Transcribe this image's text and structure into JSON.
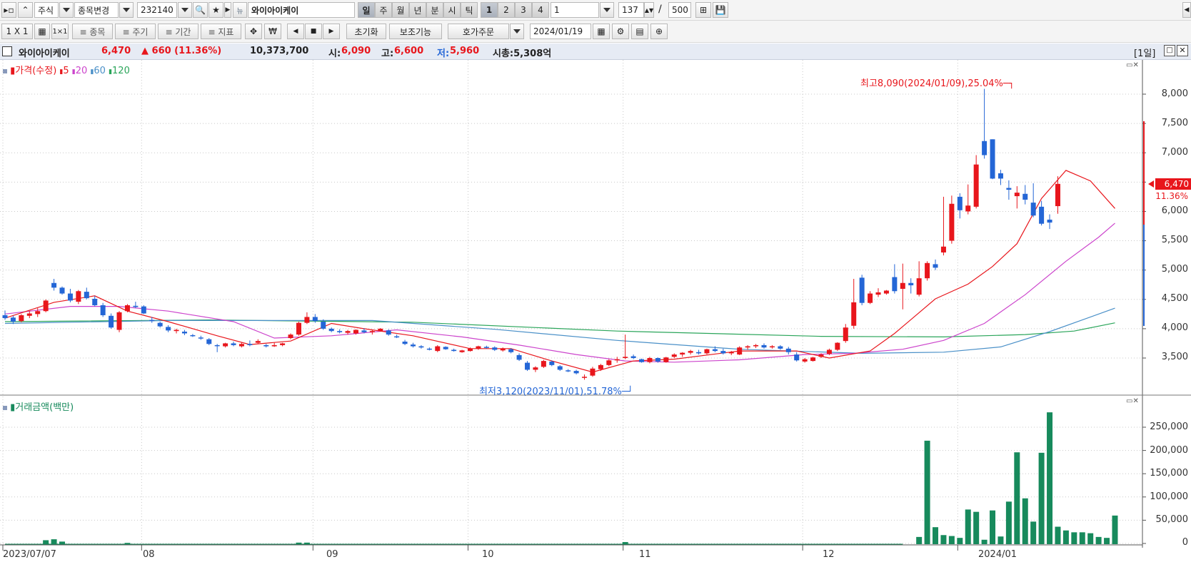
{
  "toolbar1": {
    "market": "주식",
    "change_label": "종목변경",
    "code": "232140",
    "name": "와이아이케이",
    "periods": [
      "일",
      "주",
      "월",
      "년",
      "분",
      "시",
      "틱"
    ],
    "nums": [
      "1",
      "2",
      "3",
      "4"
    ],
    "num_value": "1",
    "count": "137",
    "slash": "/",
    "max": "500"
  },
  "toolbar2": {
    "layout": "1 X 1",
    "b_item": "≡ 종목",
    "b_period": "≡ 주기",
    "b_range": "≡ 기간",
    "b_indicator": "≡ 지표",
    "reset": "초기화",
    "aux": "보조기능",
    "order": "호가주문",
    "date": "2024/01/19"
  },
  "info": {
    "name": "와이아이케이",
    "price": "6,470",
    "change": "▲ 660 (11.36%)",
    "volume": "10,373,700",
    "open_label": "시:",
    "open": "6,090",
    "high_label": "고:",
    "high": "6,600",
    "low_label": "저:",
    "low": "5,960",
    "cap": "시총:5,308억",
    "period_tag": "[1일]"
  },
  "price_panel": {
    "legend_title": "가격(수정)",
    "ma": [
      "5",
      "20",
      "60",
      "120"
    ],
    "high_note": "최고8,090(2024/01/09),25.04%",
    "low_note": "최저3,120(2023/11/01),51.78%",
    "last_price": "6,470",
    "last_pct": "11.36%",
    "y_ticks": [
      "8,000",
      "7,500",
      "7,000",
      "6,500",
      "6,000",
      "5,500",
      "5,000",
      "4,500",
      "4,000",
      "3,500"
    ]
  },
  "volume_panel": {
    "legend_title": "거래금액(백만)",
    "y_ticks": [
      "250,000",
      "200,000",
      "150,000",
      "100,000",
      "50,000",
      "0"
    ]
  },
  "x_labels": [
    "2023/07/07",
    "08",
    "09",
    "10",
    "11",
    "12",
    "2024/01"
  ],
  "colors": {
    "up": "#e8161c",
    "down": "#2466d6",
    "ma5": "#e8161c",
    "ma20": "#cc44cc",
    "ma60": "#4a90c8",
    "ma120": "#2aa55a",
    "vol": "#178a5c"
  },
  "chart_data": {
    "type": "candlestick",
    "ylim": [
      3000,
      8300
    ],
    "candles": [
      [
        4230,
        4310,
        4150,
        4180
      ],
      [
        4190,
        4220,
        4080,
        4120
      ],
      [
        4130,
        4250,
        4110,
        4230
      ],
      [
        4220,
        4300,
        4180,
        4260
      ],
      [
        4250,
        4350,
        4200,
        4300
      ],
      [
        4300,
        4500,
        4280,
        4480
      ],
      [
        4780,
        4850,
        4650,
        4700
      ],
      [
        4700,
        4720,
        4580,
        4600
      ],
      [
        4600,
        4680,
        4450,
        4480
      ],
      [
        4460,
        4660,
        4420,
        4640
      ],
      [
        4630,
        4700,
        4500,
        4520
      ],
      [
        4510,
        4560,
        4380,
        4400
      ],
      [
        4400,
        4440,
        4200,
        4230
      ],
      [
        4220,
        4260,
        4000,
        4020
      ],
      [
        3980,
        4300,
        3940,
        4280
      ],
      [
        4300,
        4420,
        4280,
        4400
      ],
      [
        4390,
        4460,
        4350,
        4370
      ],
      [
        4380,
        4400,
        4250,
        4260
      ],
      [
        4150,
        4200,
        4100,
        4130
      ],
      [
        4100,
        4120,
        4020,
        4040
      ],
      [
        4030,
        4060,
        3940,
        3970
      ],
      [
        3960,
        4000,
        3920,
        3980
      ],
      [
        3950,
        3980,
        3890,
        3920
      ],
      [
        3890,
        3910,
        3860,
        3880
      ],
      [
        3850,
        3880,
        3810,
        3840
      ],
      [
        3820,
        3840,
        3720,
        3740
      ],
      [
        3720,
        3740,
        3600,
        3710
      ],
      [
        3700,
        3760,
        3680,
        3750
      ],
      [
        3750,
        3780,
        3700,
        3720
      ],
      [
        3700,
        3760,
        3680,
        3740
      ],
      [
        3740,
        3800,
        3700,
        3720
      ],
      [
        3760,
        3820,
        3740,
        3790
      ],
      [
        3720,
        3740,
        3680,
        3700
      ],
      [
        3700,
        3760,
        3690,
        3720
      ],
      [
        3720,
        3760,
        3700,
        3750
      ],
      [
        3840,
        3920,
        3820,
        3900
      ],
      [
        3900,
        4120,
        3880,
        4100
      ],
      [
        4100,
        4280,
        4080,
        4200
      ],
      [
        4200,
        4250,
        4100,
        4130
      ],
      [
        4120,
        4160,
        3980,
        4000
      ],
      [
        4000,
        4020,
        3940,
        3960
      ],
      [
        3960,
        3990,
        3920,
        3940
      ],
      [
        3930,
        3980,
        3900,
        3960
      ],
      [
        3920,
        3990,
        3900,
        3980
      ],
      [
        3970,
        4010,
        3920,
        3940
      ],
      [
        3940,
        3980,
        3900,
        3960
      ],
      [
        3960,
        4010,
        3950,
        4000
      ],
      [
        3970,
        3990,
        3880,
        3900
      ],
      [
        3870,
        3900,
        3840,
        3860
      ],
      [
        3780,
        3810,
        3720,
        3740
      ],
      [
        3730,
        3760,
        3680,
        3700
      ],
      [
        3700,
        3720,
        3660,
        3680
      ],
      [
        3660,
        3680,
        3630,
        3650
      ],
      [
        3620,
        3720,
        3600,
        3700
      ],
      [
        3690,
        3700,
        3640,
        3650
      ],
      [
        3640,
        3660,
        3610,
        3620
      ],
      [
        3600,
        3640,
        3590,
        3630
      ],
      [
        3620,
        3680,
        3610,
        3660
      ],
      [
        3660,
        3710,
        3640,
        3700
      ],
      [
        3690,
        3710,
        3660,
        3680
      ],
      [
        3680,
        3700,
        3620,
        3640
      ],
      [
        3630,
        3680,
        3610,
        3660
      ],
      [
        3650,
        3670,
        3580,
        3600
      ],
      [
        3550,
        3580,
        3450,
        3470
      ],
      [
        3420,
        3450,
        3280,
        3300
      ],
      [
        3300,
        3360,
        3260,
        3340
      ],
      [
        3350,
        3470,
        3330,
        3450
      ],
      [
        3440,
        3460,
        3360,
        3380
      ],
      [
        3360,
        3380,
        3280,
        3300
      ],
      [
        3290,
        3310,
        3260,
        3280
      ],
      [
        3280,
        3300,
        3220,
        3240
      ],
      [
        3180,
        3220,
        3130,
        3180
      ],
      [
        3200,
        3350,
        3180,
        3320
      ],
      [
        3310,
        3400,
        3280,
        3380
      ],
      [
        3380,
        3480,
        3360,
        3460
      ],
      [
        3460,
        3520,
        3420,
        3480
      ],
      [
        3500,
        3900,
        3480,
        3520
      ],
      [
        3530,
        3560,
        3480,
        3500
      ],
      [
        3480,
        3490,
        3420,
        3430
      ],
      [
        3430,
        3520,
        3410,
        3500
      ],
      [
        3500,
        3510,
        3420,
        3440
      ],
      [
        3430,
        3520,
        3420,
        3510
      ],
      [
        3520,
        3580,
        3500,
        3560
      ],
      [
        3560,
        3600,
        3520,
        3590
      ],
      [
        3590,
        3640,
        3560,
        3620
      ],
      [
        3600,
        3640,
        3560,
        3580
      ],
      [
        3580,
        3660,
        3560,
        3650
      ],
      [
        3650,
        3700,
        3600,
        3620
      ],
      [
        3620,
        3660,
        3560,
        3580
      ],
      [
        3580,
        3620,
        3550,
        3600
      ],
      [
        3560,
        3700,
        3550,
        3680
      ],
      [
        3680,
        3720,
        3640,
        3700
      ],
      [
        3700,
        3740,
        3670,
        3720
      ],
      [
        3720,
        3750,
        3660,
        3680
      ],
      [
        3690,
        3720,
        3660,
        3700
      ],
      [
        3700,
        3720,
        3640,
        3660
      ],
      [
        3660,
        3690,
        3560,
        3600
      ],
      [
        3560,
        3600,
        3440,
        3460
      ],
      [
        3440,
        3500,
        3420,
        3480
      ],
      [
        3450,
        3520,
        3440,
        3510
      ],
      [
        3520,
        3580,
        3500,
        3560
      ],
      [
        3570,
        3660,
        3550,
        3640
      ],
      [
        3640,
        3770,
        3620,
        3760
      ],
      [
        3790,
        4080,
        3760,
        4020
      ],
      [
        4050,
        4850,
        4000,
        4450
      ],
      [
        4870,
        4920,
        4400,
        4440
      ],
      [
        4440,
        4640,
        4420,
        4600
      ],
      [
        4580,
        4690,
        4540,
        4620
      ],
      [
        4600,
        4660,
        4580,
        4650
      ],
      [
        4880,
        5100,
        4600,
        4640
      ],
      [
        4680,
        5110,
        4330,
        4780
      ],
      [
        4780,
        4860,
        4600,
        4740
      ],
      [
        4580,
        5150,
        4550,
        4860
      ],
      [
        4860,
        5150,
        4820,
        5120
      ],
      [
        5100,
        5180,
        5000,
        5040
      ],
      [
        5300,
        6250,
        5250,
        5400
      ],
      [
        5500,
        6270,
        5450,
        6130
      ],
      [
        6250,
        6310,
        5880,
        6020
      ],
      [
        6000,
        6460,
        5950,
        6100
      ],
      [
        6080,
        6960,
        6050,
        6800
      ],
      [
        7200,
        8090,
        6900,
        6960
      ],
      [
        7230,
        7230,
        6550,
        6560
      ],
      [
        6650,
        6710,
        6450,
        6560
      ],
      [
        6400,
        6530,
        6200,
        6370
      ],
      [
        6260,
        6430,
        6050,
        6320
      ],
      [
        6300,
        6450,
        6120,
        6200
      ],
      [
        6150,
        6480,
        5900,
        5930
      ],
      [
        6080,
        6180,
        5760,
        5790
      ],
      [
        5860,
        5950,
        5700,
        5810
      ],
      [
        6090,
        6600,
        5960,
        6470
      ]
    ],
    "ma5": [
      [
        0,
        4180
      ],
      [
        6,
        4450
      ],
      [
        11,
        4560
      ],
      [
        15,
        4300
      ],
      [
        20,
        4120
      ],
      [
        26,
        3880
      ],
      [
        30,
        3730
      ],
      [
        35,
        3790
      ],
      [
        40,
        4090
      ],
      [
        44,
        4000
      ],
      [
        50,
        3880
      ],
      [
        57,
        3660
      ],
      [
        62,
        3660
      ],
      [
        67,
        3450
      ],
      [
        72,
        3260
      ],
      [
        77,
        3450
      ],
      [
        82,
        3480
      ],
      [
        90,
        3620
      ],
      [
        97,
        3620
      ],
      [
        101,
        3500
      ],
      [
        106,
        3620
      ],
      [
        109,
        3920
      ],
      [
        114,
        4510
      ],
      [
        118,
        4760
      ],
      [
        121,
        5060
      ],
      [
        124,
        5450
      ],
      [
        127,
        6220
      ],
      [
        130,
        6700
      ],
      [
        133,
        6520
      ],
      [
        136,
        6050
      ]
    ],
    "ma20": [
      [
        0,
        4250
      ],
      [
        8,
        4380
      ],
      [
        14,
        4380
      ],
      [
        20,
        4300
      ],
      [
        28,
        4120
      ],
      [
        33,
        3840
      ],
      [
        40,
        3880
      ],
      [
        48,
        3980
      ],
      [
        56,
        3860
      ],
      [
        63,
        3720
      ],
      [
        70,
        3560
      ],
      [
        76,
        3450
      ],
      [
        82,
        3430
      ],
      [
        90,
        3470
      ],
      [
        98,
        3560
      ],
      [
        104,
        3580
      ],
      [
        110,
        3650
      ],
      [
        115,
        3800
      ],
      [
        120,
        4090
      ],
      [
        125,
        4580
      ],
      [
        130,
        5150
      ],
      [
        134,
        5560
      ],
      [
        136,
        5800
      ]
    ],
    "ma60": [
      [
        0,
        4090
      ],
      [
        20,
        4140
      ],
      [
        45,
        4140
      ],
      [
        60,
        3990
      ],
      [
        75,
        3800
      ],
      [
        90,
        3650
      ],
      [
        105,
        3580
      ],
      [
        115,
        3600
      ],
      [
        122,
        3690
      ],
      [
        128,
        3950
      ],
      [
        132,
        4150
      ],
      [
        136,
        4350
      ]
    ],
    "ma120": [
      [
        0,
        4120
      ],
      [
        25,
        4150
      ],
      [
        50,
        4110
      ],
      [
        75,
        3960
      ],
      [
        100,
        3870
      ],
      [
        115,
        3860
      ],
      [
        125,
        3900
      ],
      [
        131,
        3960
      ],
      [
        136,
        4100
      ]
    ],
    "volume": [
      [
        5,
        7000
      ],
      [
        6,
        9000
      ],
      [
        7,
        4000
      ],
      [
        15,
        1200
      ],
      [
        36,
        1800
      ],
      [
        37,
        1800
      ],
      [
        76,
        3000
      ],
      [
        112,
        14000
      ],
      [
        113,
        221000
      ],
      [
        114,
        35000
      ],
      [
        115,
        18000
      ],
      [
        116,
        16000
      ],
      [
        117,
        12000
      ],
      [
        118,
        73000
      ],
      [
        119,
        68000
      ],
      [
        120,
        8000
      ],
      [
        121,
        71000
      ],
      [
        122,
        15000
      ],
      [
        123,
        90000
      ],
      [
        124,
        196000
      ],
      [
        125,
        97000
      ],
      [
        126,
        47000
      ],
      [
        127,
        195000
      ],
      [
        128,
        282000
      ],
      [
        129,
        36000
      ],
      [
        130,
        28000
      ],
      [
        131,
        24000
      ],
      [
        132,
        24000
      ],
      [
        133,
        22000
      ],
      [
        134,
        14000
      ],
      [
        135,
        12000
      ],
      [
        136,
        60000
      ]
    ],
    "volume_ylim": [
      0,
      290000
    ]
  }
}
